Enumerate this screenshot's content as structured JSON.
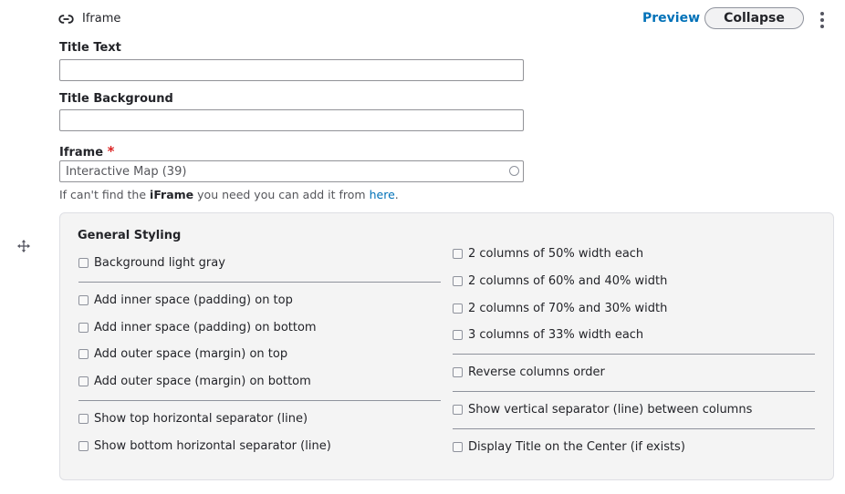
{
  "header": {
    "paragraph_type": "Iframe",
    "preview_label": "Preview",
    "collapse_label": "Collapse",
    "link_icon": "link-icon",
    "menu_icon": "vertical-ellipsis-icon"
  },
  "fields": {
    "title_text": {
      "label": "Title Text",
      "value": ""
    },
    "title_background": {
      "label": "Title Background",
      "value": ""
    },
    "iframe": {
      "label": "Iframe",
      "required_marker": "*",
      "value": "Interactive Map (39)",
      "help_prefix": "If can't find the ",
      "help_bold": "iFrame",
      "help_middle": " you need you can add it from ",
      "help_link": "here",
      "help_suffix": "."
    }
  },
  "styling": {
    "title": "General Styling",
    "left_options": [
      "Background light gray",
      "Add inner space (padding) on top",
      "Add inner space (padding) on bottom",
      "Add outer space (margin) on top",
      "Add outer space (margin) on bottom",
      "Show top horizontal separator (line)",
      "Show bottom horizontal separator (line)"
    ],
    "right_options": [
      "2 columns of 50% width each",
      "2 columns of 60% and 40% width",
      "2 columns of 70% and 30% width",
      "3 columns of 33% width each",
      "Reverse columns order",
      "Show vertical separator (line) between columns",
      "Display Title on the Center (if exists)"
    ]
  },
  "colors": {
    "link": "#0071b8",
    "required": "#dc2323",
    "panel_background": "#f4f4f4"
  }
}
